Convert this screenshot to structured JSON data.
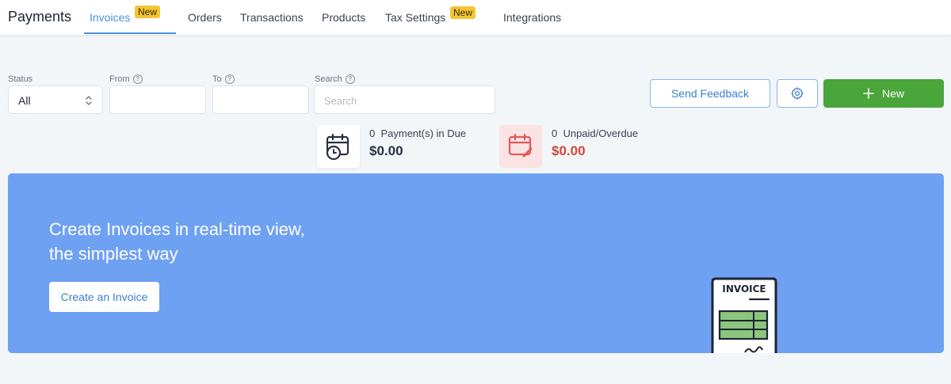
{
  "app": {
    "title": "Payments"
  },
  "nav": {
    "tabs": [
      {
        "label": "Invoices",
        "badge": "New",
        "active": true
      },
      {
        "label": "Orders"
      },
      {
        "label": "Transactions"
      },
      {
        "label": "Products"
      },
      {
        "label": "Tax Settings",
        "badge": "New"
      },
      {
        "label": "Integrations"
      }
    ]
  },
  "filters": {
    "status": {
      "label": "Status",
      "value": "All"
    },
    "from": {
      "label": "From",
      "value": ""
    },
    "to": {
      "label": "To",
      "value": ""
    },
    "search": {
      "label": "Search",
      "placeholder": "Search",
      "value": ""
    }
  },
  "actions": {
    "feedback_label": "Send Feedback",
    "settings_icon": "gear-icon",
    "new_label": "New"
  },
  "stats": {
    "due": {
      "count": "0",
      "label": "Payment(s) in Due",
      "amount": "$0.00",
      "icon": "calendar-clock-icon"
    },
    "unpaid": {
      "count": "0",
      "label": "Unpaid/Overdue",
      "amount": "$0.00",
      "icon": "calendar-edit-icon"
    }
  },
  "banner": {
    "title_line1": "Create Invoices in real-time view,",
    "title_line2": "the simplest way",
    "cta_label": "Create an Invoice",
    "illustration_label": "INVOICE"
  },
  "colors": {
    "accent": "#4d8fe0",
    "new_button": "#4aa53b",
    "banner_bg": "#6ea1f2",
    "badge": "#f3c535",
    "overdue": "#d2473c"
  }
}
